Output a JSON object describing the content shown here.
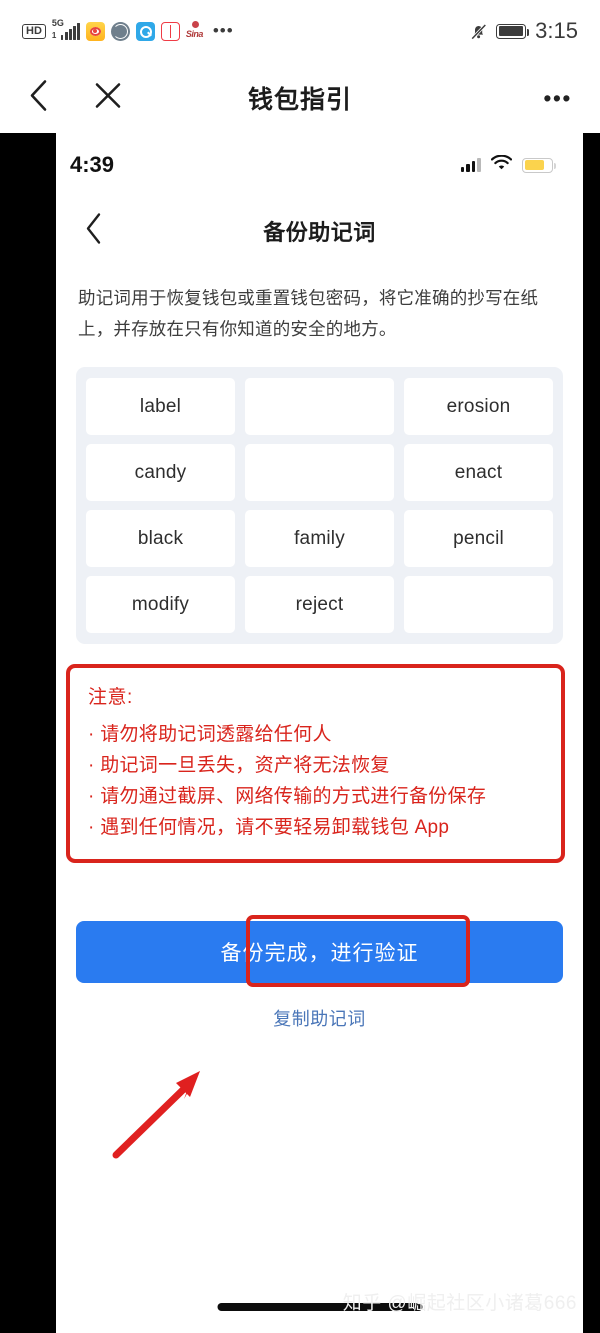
{
  "android_status": {
    "hd_label": "HD",
    "network_label": "5G",
    "network_sub": "1",
    "app_icons": [
      "weibo-icon",
      "globe-icon",
      "search-icon",
      "book-icon",
      "sina-icon"
    ],
    "overflow": "•••",
    "bell_icon": "bell-muted-icon",
    "battery_icon": "battery-full-icon",
    "time": "3:15"
  },
  "android_nav": {
    "back_icon": "chevron-left-icon",
    "close_icon": "close-icon",
    "title": "钱包指引",
    "more_icon": "more-horizontal-icon",
    "more_glyph": "•••"
  },
  "inner": {
    "status": {
      "time": "4:39",
      "signal_icon": "cellular-signal-icon",
      "wifi_icon": "wifi-icon",
      "battery_icon": "battery-low-icon"
    },
    "nav": {
      "back_icon": "chevron-left-icon",
      "title": "备份助记词"
    },
    "description": "助记词用于恢复钱包或重置钱包密码，将它准确的抄写在纸上，并存放在只有你知道的安全的地方。",
    "mnemonic_words": [
      "label",
      "",
      "erosion",
      "candy",
      "",
      "enact",
      "black",
      "family",
      "pencil",
      "modify",
      "reject",
      ""
    ],
    "warning": {
      "title": "注意:",
      "items": [
        "· 请勿将助记词透露给任何人",
        "· 助记词一旦丢失，资产将无法恢复",
        "· 请勿通过截屏、网络传输的方式进行备份保存",
        "· 遇到任何情况，请不要轻易卸载钱包 App"
      ]
    },
    "primary_button": "备份完成，进行验证",
    "copy_link": "复制助记词"
  },
  "annotations": {
    "arrow_icon": "red-arrow-pointing-up-right",
    "highlight_icon": "red-rect-highlight"
  },
  "watermark": "知乎 @崛起社区小诸葛666",
  "colors": {
    "primary_blue": "#2a7bf0",
    "warn_red": "#d9241c",
    "grid_bg": "#eef1f6",
    "link_blue": "#4a76b8"
  }
}
